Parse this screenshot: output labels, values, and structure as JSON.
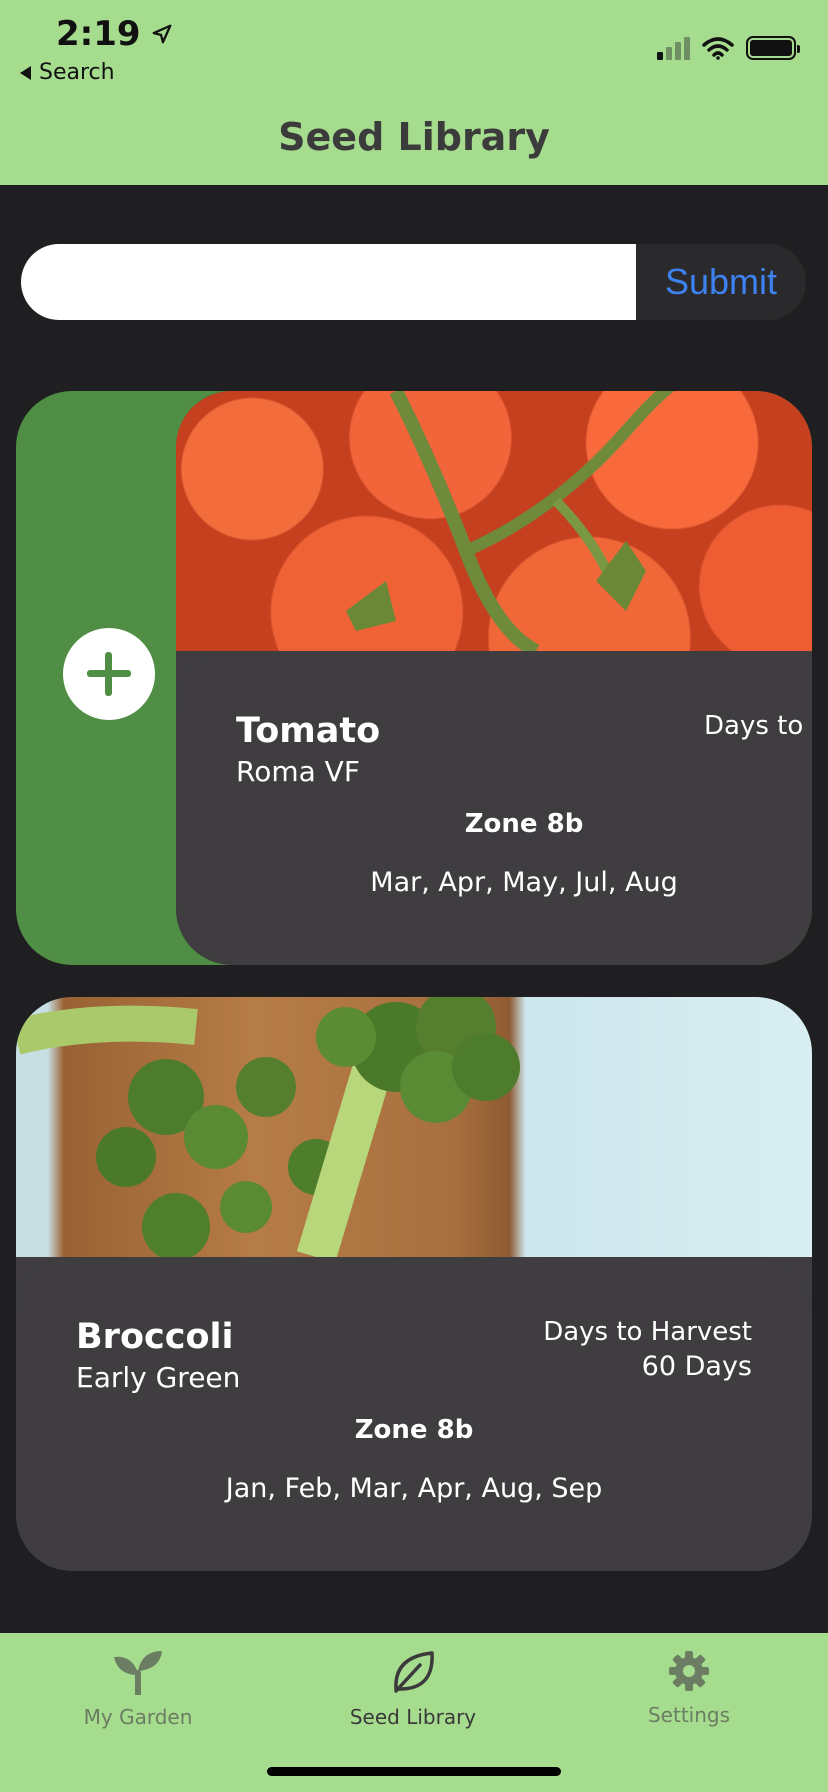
{
  "status_bar": {
    "time": "2:19",
    "back_label": "Search"
  },
  "header": {
    "title": "Seed Library"
  },
  "search": {
    "value": "",
    "placeholder": "",
    "submit_label": "Submit"
  },
  "seeds": [
    {
      "crop": "Tomato",
      "variety": "Roma VF",
      "days_label": "Days to Harvest",
      "zone": "Zone 8b",
      "months": "Mar, Apr, May, Jul, Aug"
    },
    {
      "crop": "Broccoli",
      "variety": "Early Green",
      "days_label": "Days to Harvest",
      "days_value": "60 Days",
      "zone": "Zone 8b",
      "months": "Jan, Feb, Mar, Apr, Aug, Sep"
    }
  ],
  "tabs": [
    {
      "label": "My Garden",
      "icon": "sprout-icon"
    },
    {
      "label": "Seed Library",
      "icon": "leaf-icon",
      "active": true
    },
    {
      "label": "Settings",
      "icon": "gear-icon"
    }
  ],
  "colors": {
    "header_bg": "#a6dc8e",
    "add_action_bg": "#4f8e44",
    "card_bg": "#3f3d40",
    "submit_text": "#3d82f0"
  }
}
